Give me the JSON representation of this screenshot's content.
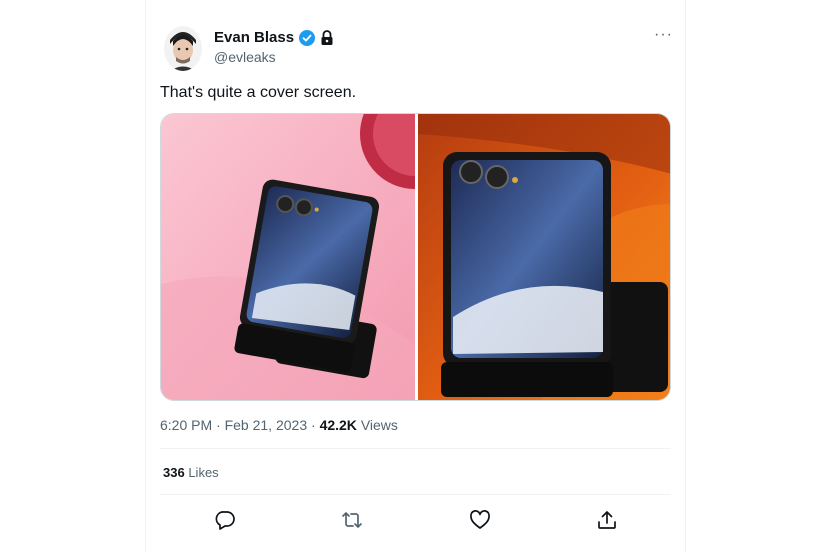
{
  "author": {
    "name": "Evan Blass",
    "handle": "@evleaks",
    "verified_icon": "verified-badge-icon",
    "lock_icon": "lock-icon",
    "avatar": "avatar"
  },
  "more_menu": {
    "icon": "more-options-icon",
    "label": "···"
  },
  "tweet": {
    "text": "That's quite a cover screen."
  },
  "meta": {
    "time": "6:20 PM",
    "separator": "·",
    "date": "Feb 21, 2023",
    "separator2": "·",
    "views_count": "42.2K",
    "views_label": "Views"
  },
  "engagement": {
    "likes_count": "336",
    "likes_label": "Likes"
  },
  "actions": [
    {
      "icon": "reply-icon"
    },
    {
      "icon": "retweet-icon"
    },
    {
      "icon": "like-heart-icon"
    },
    {
      "icon": "share-icon"
    }
  ],
  "colors": {
    "accent": "#1d9bf0",
    "text": "#0f1419",
    "secondary": "#536471",
    "border": "#eff3f4",
    "pink_bg": "#f7b7c6",
    "orange_bg": "#e9661a"
  }
}
